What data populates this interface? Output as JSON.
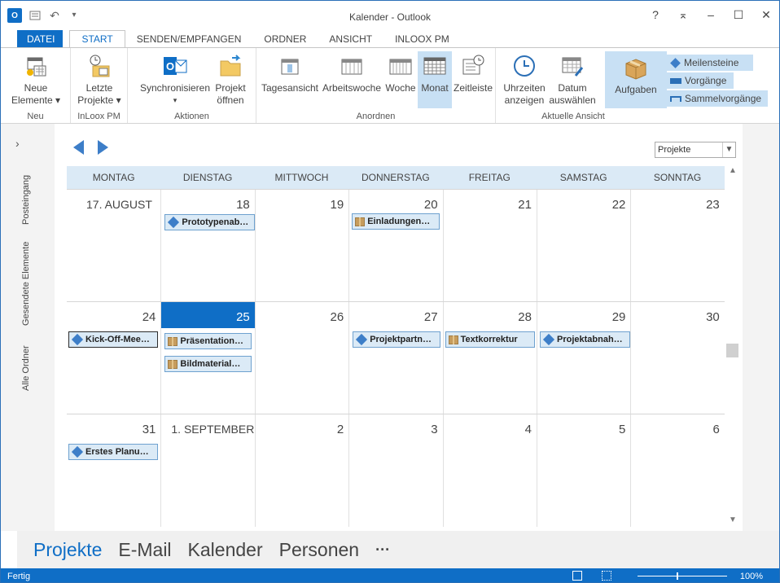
{
  "window": {
    "title": "Kalender - Outlook",
    "app_icon": "O",
    "controls": {
      "help": "?",
      "restore_ribbon": "⌅",
      "minimize": "–",
      "maximize": "☐",
      "close": "✕"
    }
  },
  "qat": {
    "undo": "↶",
    "customize": "▾"
  },
  "tabs": [
    "DATEI",
    "START",
    "SENDEN/EMPFANGEN",
    "ORDNER",
    "ANSICHT",
    "INLOOX PM"
  ],
  "ribbon": {
    "neu": {
      "label": "Neu",
      "btn_line1": "Neue",
      "btn_line2": "Elemente ▾"
    },
    "inloox": {
      "label": "InLoox PM",
      "btn_line1": "Letzte",
      "btn_line2": "Projekte ▾"
    },
    "aktionen": {
      "label": "Aktionen",
      "sync_line1": "Synchronisieren",
      "sync_line2": "▾",
      "open_line1": "Projekt",
      "open_line2": "öffnen"
    },
    "anordnen": {
      "label": "Anordnen",
      "buttons": [
        "Tagesansicht",
        "Arbeitswoche",
        "Woche",
        "Monat",
        "Zeitleiste"
      ]
    },
    "aktuelle": {
      "label": "Aktuelle Ansicht",
      "times_line1": "Uhrzeiten",
      "times_line2": "anzeigen",
      "date_line1": "Datum",
      "date_line2": "auswählen",
      "tasks": "Aufgaben",
      "milestones": "Meilensteine",
      "processes": "Vorgänge",
      "summary": "Sammelvorgänge"
    }
  },
  "navpane": {
    "folders": [
      "Posteingang",
      "Gesendete Elemente",
      "Alle Ordner"
    ]
  },
  "calendar": {
    "project_filter": "Projekte",
    "days": [
      "MONTAG",
      "DIENSTAG",
      "MITTWOCH",
      "DONNERSTAG",
      "FREITAG",
      "SAMSTAG",
      "SONNTAG"
    ],
    "weeks": [
      [
        "17. AUGUST",
        "18",
        "19",
        "20",
        "21",
        "22",
        "23"
      ],
      [
        "24",
        "25",
        "26",
        "27",
        "28",
        "29",
        "30"
      ],
      [
        "31",
        "1. SEPTEMBER",
        "2",
        "3",
        "4",
        "5",
        "6"
      ]
    ],
    "events": {
      "prototypen": "Prototypenab…",
      "einladungen": "Einladungen…",
      "kickoff": "Kick-Off-Mee…",
      "praesentation": "Präsentation…",
      "bildmaterial": "Bildmaterial…",
      "projektpartn": "Projektpartn…",
      "textkorrektur": "Textkorrektur",
      "projektabnah": "Projektabnah…",
      "erstes": "Erstes Planu…"
    }
  },
  "bottom_nav": {
    "projekte": "Projekte",
    "email": "E-Mail",
    "kalender": "Kalender",
    "personen": "Personen",
    "more": "···"
  },
  "status": {
    "text": "Fertig",
    "zoom": "100%"
  }
}
